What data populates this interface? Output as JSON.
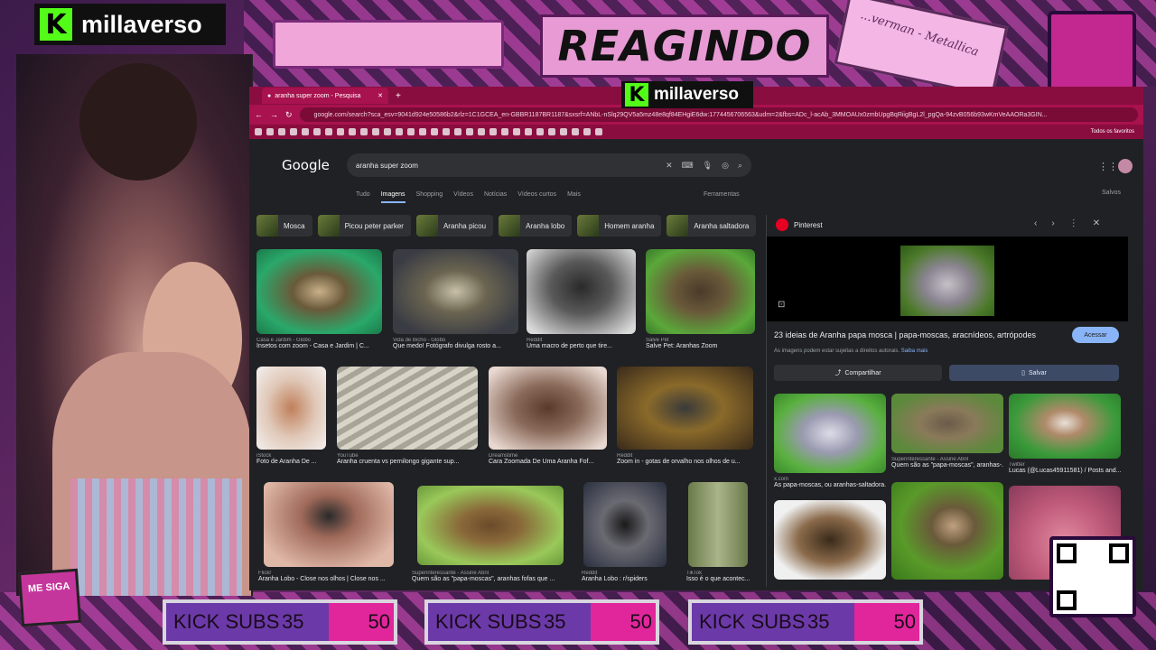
{
  "stream": {
    "channel_name": "millaverso",
    "title": "REAGINDO",
    "now_playing": "...verman - Metallica",
    "follow_label": "ME SIGA",
    "sub_goals": [
      {
        "label": "KICK SUBS",
        "current": "35",
        "goal": "50",
        "progress_fraction": 0.7
      },
      {
        "label": "KICK SUBS",
        "current": "35",
        "goal": "50",
        "progress_fraction": 0.7
      },
      {
        "label": "KICK SUBS",
        "current": "35",
        "goal": "50",
        "progress_fraction": 0.7
      }
    ],
    "colors": {
      "accent": "#e0269a",
      "kick_green": "#53fc18",
      "purple": "#6b3aa8"
    }
  },
  "browser": {
    "tab_title": "aranha super zoom - Pesquisa",
    "url": "google.com/search?sca_esv=9041d924e50586b2&rlz=1C1GCEA_en-GBBR1187BR1187&sxsrf=ANbL-nSlq29QV5a5mz48e8qf84EHgiE6dw:1774456706563&udm=2&fbs=ADc_l-acAb_3MMOAUx0zmbUpgBqRiigBgL2l_pgQa-94zvB056b93wKmVeAAORa3GIN...",
    "bookmarks_label": "Todos os favoritos"
  },
  "google": {
    "logo": "Google",
    "query": "aranha super zoom",
    "tabs": [
      "Tudo",
      "Imagens",
      "Shopping",
      "Vídeos",
      "Notícias",
      "Vídeos curtos",
      "Mais"
    ],
    "active_tab": "Imagens",
    "tools_label": "Ferramentas",
    "saved_label": "Salvos",
    "chips": [
      "Mosca",
      "Picou peter parker",
      "Aranha picou",
      "Aranha lobo",
      "Homem aranha",
      "Aranha saltadora"
    ],
    "results": [
      {
        "source": "Casa e Jardim - Globo",
        "title": "Insetos com zoom - Casa e Jardim | C..."
      },
      {
        "source": "Vida de Bicho - Globo",
        "title": "Que medo! Fotógrafo divulga rosto a..."
      },
      {
        "source": "Reddit",
        "title": "Uma macro de perto que tire..."
      },
      {
        "source": "Salve Pet",
        "title": "Salve Pet: Aranhas Zoom"
      },
      {
        "source": "iStock",
        "title": "Foto de Aranha De ..."
      },
      {
        "source": "YouTube",
        "title": "Aranha cruenta vs pernilongo gigante sup..."
      },
      {
        "source": "Dreamstime",
        "title": "Cara Zoomada De Uma Aranha Fof..."
      },
      {
        "source": "Reddit",
        "title": "Zoom in - gotas de orvalho nos olhos de u..."
      },
      {
        "source": "Flickr",
        "title": "Aranha Lobo - Close nos olhos | Close nos ..."
      },
      {
        "source": "Superinteressante - Assine Abril",
        "title": "Quem são as \"papa-moscas\", aranhas fofas que ..."
      },
      {
        "source": "Reddit",
        "title": "Aranha Lobo : r/spiders"
      },
      {
        "source": "TikTok",
        "title": "Isso é o que acontec..."
      }
    ]
  },
  "panel": {
    "source": "Pinterest",
    "title": "23 ideias de Aranha papa mosca | papa-moscas, aracnídeos, artrópodes",
    "visit_label": "Acessar",
    "note": "As imagens podem estar sujeitas a direitos autorais.",
    "note_link": "Saiba mais",
    "share_label": "Compartilhar",
    "save_label": "Salvar",
    "related": [
      {
        "source": "x.com",
        "title": "As papa-moscas, ou aranhas-saltadora..."
      },
      {
        "source": "Superinteressante - Assine Abril",
        "title": "Quem são as \"papa-moscas\", aranhas-..."
      },
      {
        "source": "Twitter",
        "title": "Lucas (@Lucas45911581) / Posts and..."
      }
    ]
  }
}
